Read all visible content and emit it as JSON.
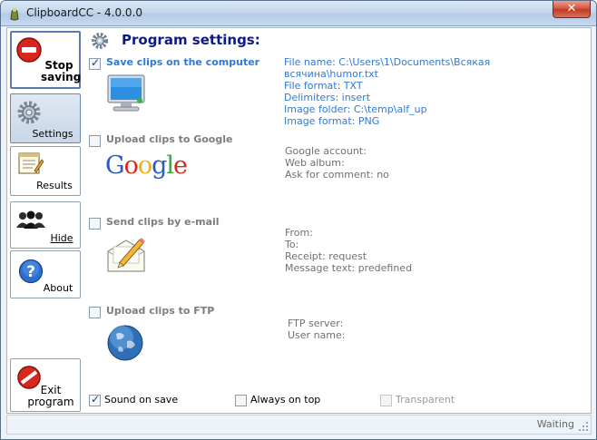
{
  "window": {
    "title": "ClipboardCC - 4.0.0.0",
    "close_glyph": "✕"
  },
  "sidebar": {
    "stop": {
      "label_line1": "Stop",
      "label_line2": "saving",
      "icon": "stop-icon"
    },
    "settings": {
      "label": "Settings",
      "icon": "gear-icon"
    },
    "results": {
      "label": "Results",
      "icon": "notepad-icon"
    },
    "hide": {
      "label": "Hide",
      "icon": "users-icon"
    },
    "about": {
      "label": "About",
      "icon": "help-icon"
    },
    "exit": {
      "label_line1": "Exit",
      "label_line2": "program",
      "icon": "exit-icon"
    }
  },
  "main": {
    "heading": "Program settings:",
    "sections": {
      "computer": {
        "label": "Save clips on the computer",
        "checked": true,
        "icon": "monitor-icon",
        "info": "File name: C:\\Users\\1\\Documents\\Всякая\nвсячина\\humor.txt\nFile format: TXT\nDelimiters: insert\nImage folder: C:\\temp\\alf_up\nImage format: PNG"
      },
      "google": {
        "label": "Upload clips to Google",
        "checked": false,
        "icon": "google-logo-icon",
        "logo_letters": [
          "G",
          "o",
          "o",
          "g",
          "l",
          "e"
        ],
        "info": "Google account:\nWeb album:\nAsk for comment: no"
      },
      "email": {
        "label": "Send clips by e-mail",
        "checked": false,
        "icon": "envelope-pencil-icon",
        "info": "From:\nTo:\nReceipt: request\nMessage text: predefined"
      },
      "ftp": {
        "label": "Upload clips to FTP",
        "checked": false,
        "icon": "globe-icon",
        "info": "FTP server:\nUser name:"
      }
    },
    "options": {
      "sound": {
        "label": "Sound on save",
        "checked": true
      },
      "top": {
        "label": "Always on top",
        "checked": false
      },
      "transparent": {
        "label": "Transparent",
        "checked": false,
        "disabled": true
      }
    }
  },
  "status": {
    "text": "Waiting"
  },
  "colors": {
    "active_blue": "#2f7ad6",
    "heading_blue": "#0d1a8a",
    "inactive_gray": "#7d7d7d"
  }
}
